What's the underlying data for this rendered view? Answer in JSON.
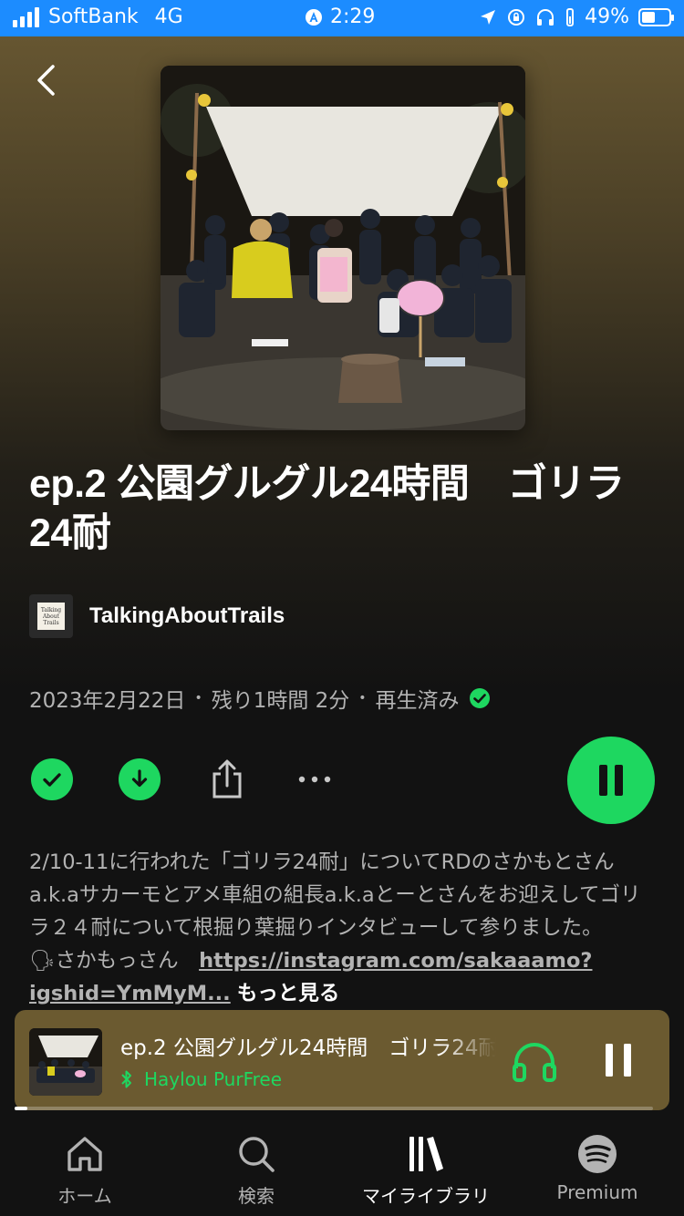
{
  "status_bar": {
    "carrier": "SoftBank",
    "network": "4G",
    "time": "2:29",
    "battery": "49%",
    "battery_level": 0.49,
    "background_color": "#1c8cff"
  },
  "episode": {
    "title": "ep.2 公園グルグル24時間　ゴリラ24耐",
    "show_name": "TalkingAboutTrails",
    "show_thumb_text": "Talking About Trails",
    "date": "2023年2月22日",
    "remaining": "残り1時間 2分",
    "played_status": "再生済み"
  },
  "description": {
    "text": "2/10-11に行われた「ゴリラ24耐」についてRDのさかもとさんa.k.aサカーモとアメ車組の組長a.k.aとーとさんをお迎えしてゴリラ２４耐について根掘り葉掘りインタビューして参りました。　　🗣さかもっさん　",
    "link": "https://instagram.com/sakaaamo?igshid=YmMyM...",
    "more_label": "もっと見る"
  },
  "actions": {
    "icons": [
      "check-icon",
      "download-icon",
      "share-icon",
      "more-icon",
      "pause-icon"
    ]
  },
  "mini_player": {
    "title": "ep.2 公園グルグル24時間　ゴリラ24耐",
    "device": "Haylou PurFree",
    "progress": 0.02,
    "background_color": "#6b5a30"
  },
  "nav": {
    "items": [
      {
        "label": "ホーム",
        "icon": "home-icon"
      },
      {
        "label": "検索",
        "icon": "search-icon"
      },
      {
        "label": "マイライブラリ",
        "icon": "library-icon"
      },
      {
        "label": "Premium",
        "icon": "spotify-icon"
      }
    ],
    "active_index": 2
  },
  "colors": {
    "accent": "#1ed760",
    "text_secondary": "#b3b3b3",
    "background": "#121212"
  }
}
